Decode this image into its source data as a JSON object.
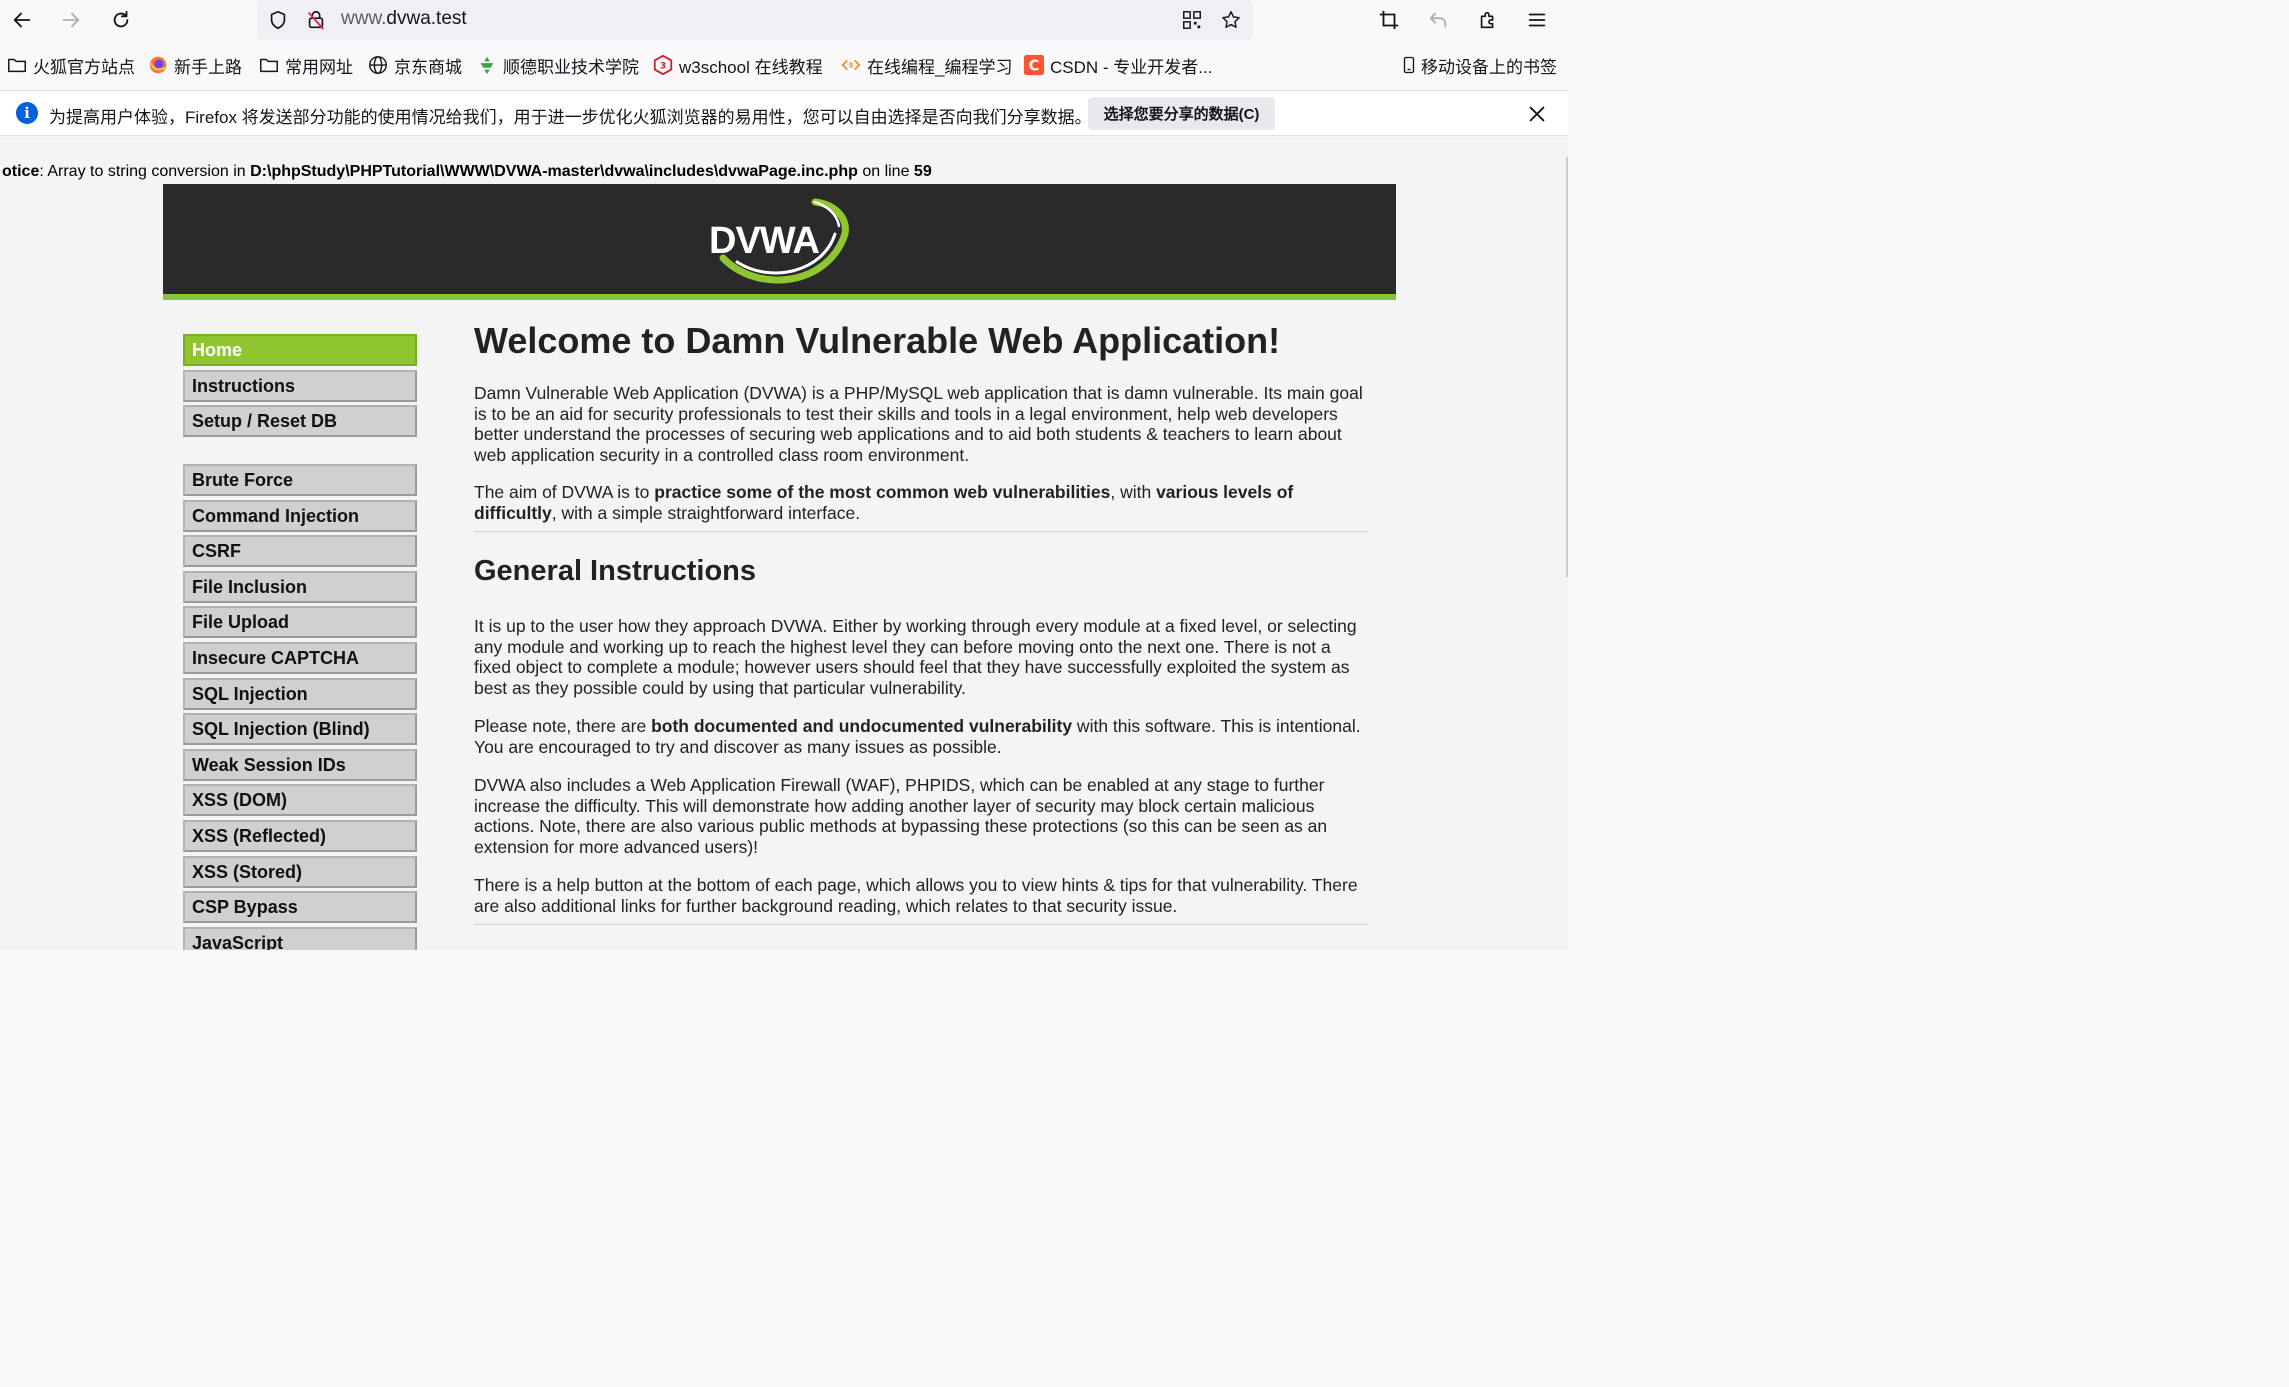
{
  "browser": {
    "url_prefix": "www.",
    "url_domain": "dvwa.test",
    "icons": [
      "back-icon",
      "forward-icon",
      "reload-icon",
      "shield-icon",
      "insecure-lock-icon",
      "qr-code-icon",
      "star-icon",
      "crop-icon",
      "undo-icon",
      "extensions-icon",
      "menu-icon"
    ]
  },
  "bookmarks": {
    "items": [
      {
        "label": "火狐官方站点",
        "icon": "folder-icon"
      },
      {
        "label": "新手上路",
        "icon": "firefox-icon"
      },
      {
        "label": "常用网址",
        "icon": "folder-icon"
      },
      {
        "label": "京东商城",
        "icon": "globe-icon"
      },
      {
        "label": "顺德职业技术学院",
        "icon": "college-icon"
      },
      {
        "label": "w3school 在线教程",
        "icon": "w3school-icon"
      },
      {
        "label": "在线编程_编程学习",
        "icon": "code-icon"
      },
      {
        "label": "CSDN - 专业开发者...",
        "icon": "csdn-icon"
      }
    ],
    "mobile": "移动设备上的书签"
  },
  "notification": {
    "text": "为提高用户体验，Firefox 将发送部分功能的使用情况给我们，用于进一步优化火狐浏览器的易用性，您可以自由选择是否向我们分享数据。",
    "button": "选择您要分享的数据(C)"
  },
  "notice": {
    "prefix": "otice",
    "message": ": Array to string conversion in ",
    "path": "D:\\phpStudy\\PHPTutorial\\WWW\\DVWA-master\\dvwa\\includes\\dvwaPage.inc.php",
    "on_line": " on line ",
    "line": "59"
  },
  "logo_text": "DVWA",
  "menu": {
    "group1": [
      "Home",
      "Instructions",
      "Setup / Reset DB"
    ],
    "group2": [
      "Brute Force",
      "Command Injection",
      "CSRF",
      "File Inclusion",
      "File Upload",
      "Insecure CAPTCHA",
      "SQL Injection",
      "SQL Injection (Blind)",
      "Weak Session IDs",
      "XSS (DOM)",
      "XSS (Reflected)",
      "XSS (Stored)",
      "CSP Bypass",
      "JavaScript"
    ],
    "selected": "Home"
  },
  "content": {
    "title": "Welcome to Damn Vulnerable Web Application!",
    "intro": "Damn Vulnerable Web Application (DVWA) is a PHP/MySQL web application that is damn vulnerable. Its main goal is to be an aid for security professionals to test their skills and tools in a legal environment, help web developers better understand the processes of securing web applications and to aid both students & teachers to learn about web application security in a controlled class room environment.",
    "aim_1": "The aim of DVWA is to ",
    "aim_2": "practice some of the most common web vulnerabilities",
    "aim_3": ", with ",
    "aim_4": "various levels of difficultly",
    "aim_5": ", with a simple straightforward interface.",
    "general_title": "General Instructions",
    "general_1": "It is up to the user how they approach DVWA. Either by working through every module at a fixed level, or selecting any module and working up to reach the highest level they can before moving onto the next one. There is not a fixed object to complete a module; however users should feel that they have successfully exploited the system as best as they possible could by using that particular vulnerability.",
    "note_1": "Please note, there are ",
    "note_2": "both documented and undocumented vulnerability",
    "note_3": " with this software. This is intentional. You are encouraged to try and discover as many issues as possible.",
    "waf": "DVWA also includes a Web Application Firewall (WAF), PHPIDS, which can be enabled at any stage to further increase the difficulty. This will demonstrate how adding another layer of security may block certain malicious actions. Note, there are also various public methods at bypassing these protections (so this can be seen as an extension for more advanced users)!",
    "help": "There is a help button at the bottom of each page, which allows you to view hints & tips for that vulnerability. There are also additional links for further background reading, which relates to that security issue."
  },
  "colors": {
    "accent_green": "#8fc630",
    "header_dark": "#2a2a2a",
    "menu_gray": "#d0d0d0"
  }
}
